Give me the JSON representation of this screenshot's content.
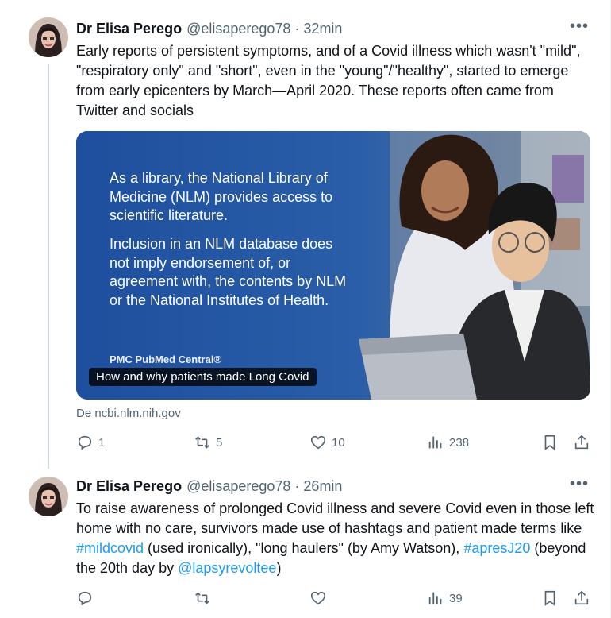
{
  "tweets": [
    {
      "author_name": "Dr Elisa Perego",
      "handle_time": "@elisaperego78 · 32min",
      "more_icon": "more-horizontal-icon",
      "text": "Early reports of persistent symptoms, and of a Covid illness which wasn't \"mild\", \"respiratory only\" and \"short\", even in the \"young\"/\"healthy\", started to emerge from early epicenters by March—April 2020. These reports often came from Twitter and socials",
      "card": {
        "text_1": "As a library, the National Library of Medicine (NLM) provides access to scientific literature.",
        "text_2": "Inclusion in an NLM database does not imply endorsement of, or agreement with, the contents by NLM or the National Institutes of Health.",
        "logo_text": "PMC PubMed Central®",
        "caption": "How and why patients made Long Covid",
        "source": "De ncbi.nlm.nih.gov"
      },
      "actions": {
        "replies": "1",
        "retweets": "5",
        "likes": "10",
        "views": "238"
      }
    },
    {
      "author_name": "Dr Elisa Perego",
      "handle_time": "@elisaperego78 · 26min",
      "more_icon": "more-horizontal-icon",
      "text_parts": {
        "p1": "To raise awareness of prolonged Covid illness and severe Covid even in those left home with no care, survivors made use of hashtags and patient made terms like ",
        "hashtag1": "#mildcovid",
        "p2": " (used ironically), \"long haulers\" (by Amy Watson), ",
        "hashtag2": "#apresJ20",
        "p3": " (beyond the 20th day by ",
        "mention": "@lapsyrevoltee",
        "p4": ")"
      },
      "actions": {
        "replies": "",
        "retweets": "",
        "likes": "",
        "views": "39"
      }
    }
  ],
  "colors": {
    "link": "#1d9bf0",
    "secondary_text": "#536471",
    "card_blue": "#1b4fa0"
  }
}
